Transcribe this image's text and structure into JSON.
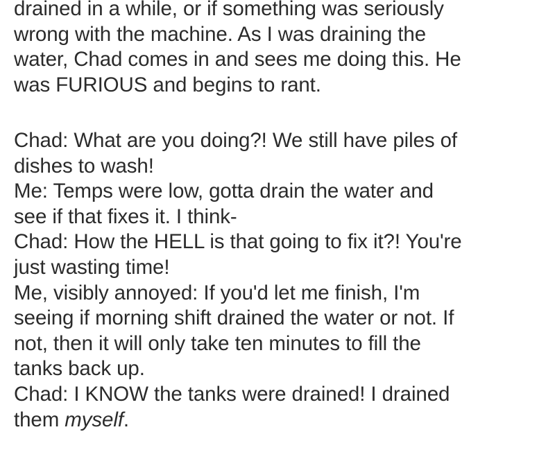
{
  "paragraphs": [
    {
      "lines": [
        "drained in a while, or if something was seriously",
        "wrong with the machine. As I was draining the",
        "water, Chad comes in and sees me doing this. He",
        "was FURIOUS and begins to rant."
      ]
    },
    {
      "lines": [
        "Chad: What are you doing?! We still have piles of",
        "dishes to wash!",
        "Me: Temps were low, gotta drain the water and",
        "see if that fixes it. I think-",
        "Chad: How the HELL is that going to fix it?! You're",
        "just wasting time!",
        "Me, visibly annoyed: If you'd let me finish, I'm",
        "seeing if morning shift drained the water or not. If",
        "not, then it will only take ten minutes to fill the",
        "tanks back up.",
        "Chad: I KNOW the tanks were drained! I drained"
      ],
      "last_line": {
        "prefix": "them ",
        "emphasis": "myself",
        "suffix": "."
      }
    }
  ]
}
